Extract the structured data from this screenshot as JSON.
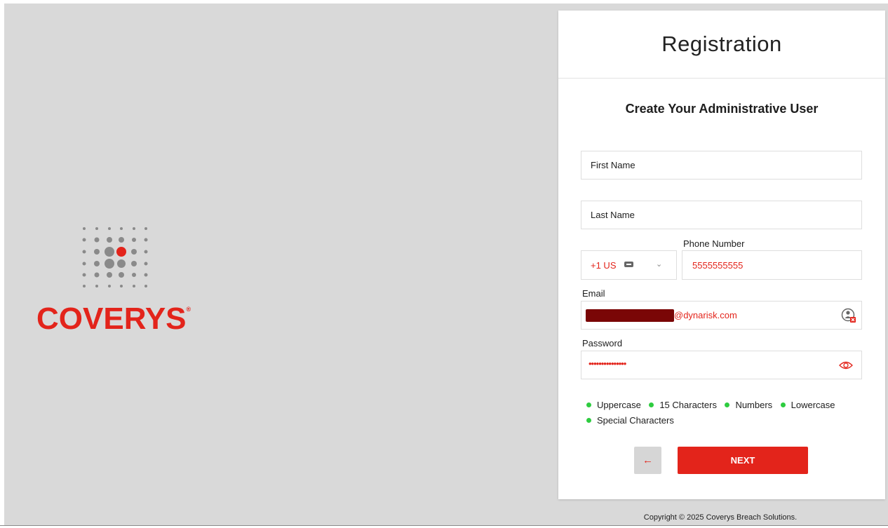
{
  "logo": {
    "text": "COVERYS",
    "mark": "®",
    "icon": "coverys-dot-grid-logo"
  },
  "panel": {
    "title": "Registration",
    "subtitle": "Create Your Administrative User"
  },
  "form": {
    "first_name": {
      "value": "First Name"
    },
    "last_name": {
      "value": "Last Name"
    },
    "phone": {
      "label": "Phone Number",
      "country_code": "+1 US",
      "value": "5555555555"
    },
    "email": {
      "label": "Email",
      "value": "@dynarisk.com"
    },
    "password": {
      "label": "Password",
      "value": "•••••••••••••••"
    }
  },
  "requirements": [
    {
      "label": "Uppercase"
    },
    {
      "label": "15 Characters"
    },
    {
      "label": "Numbers"
    },
    {
      "label": "Lowercase"
    },
    {
      "label": "Special Characters"
    }
  ],
  "buttons": {
    "back_label": "←",
    "next_label": "NEXT"
  },
  "footer": {
    "copyright": "Copyright © 2025 Coverys Breach Solutions."
  },
  "colors": {
    "accent": "#e3241b",
    "valid": "#2ecc40",
    "background": "#d9d9d9"
  }
}
